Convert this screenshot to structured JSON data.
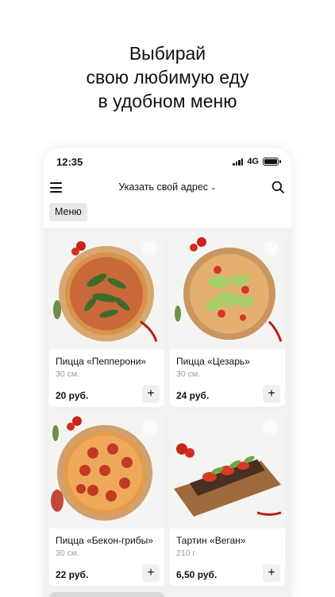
{
  "promo": {
    "line1": "Выбирай",
    "line2": "свою любимую еду",
    "line3": "в удобном меню"
  },
  "status_bar": {
    "time": "12:35",
    "network": "4G"
  },
  "header": {
    "address_label": "Указать свой адрес",
    "menu_icon": "hamburger-icon",
    "search_icon": "search-icon"
  },
  "category_chip": "Меню",
  "products": [
    {
      "name": "Пицца «Пепперони»",
      "size": "30 см.",
      "price": "20 руб.",
      "add": "+"
    },
    {
      "name": "Пицца «Цезарь»",
      "size": "30 см.",
      "price": "24 руб.",
      "add": "+"
    },
    {
      "name": "Пицца «Бекон-грибы»",
      "size": "30 см.",
      "price": "22 руб.",
      "add": "+"
    },
    {
      "name": "Тартин «Веган»",
      "size": "210 г",
      "price": "6,50 руб.",
      "add": "+"
    }
  ],
  "colors": {
    "background": "#ffffff",
    "screen_bg": "#f2f2f4",
    "chip_bg": "#e9e9ec",
    "muted_text": "#9a9a9a"
  }
}
